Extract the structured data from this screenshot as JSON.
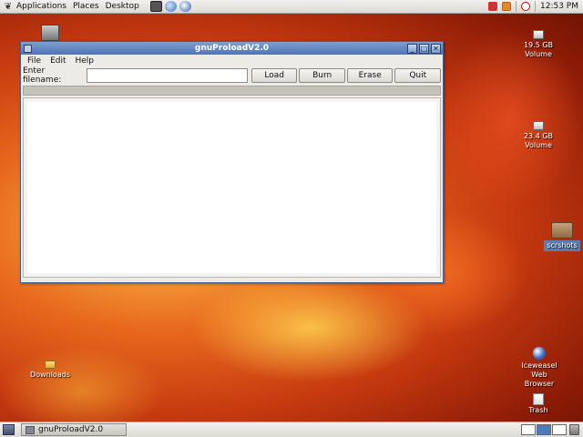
{
  "top_panel": {
    "menus": [
      "Applications",
      "Places",
      "Desktop"
    ],
    "clock": "12:53 PM"
  },
  "desktop_icons": {
    "drive1": {
      "line1": "19.5 GB",
      "line2": "Volume"
    },
    "drive2": {
      "line1": "23.4 GB",
      "line2": "Volume"
    },
    "folder": "scrshots",
    "downloads": "Downloads",
    "browser": {
      "line1": "Iceweasel",
      "line2": "Web",
      "line3": "Browser"
    },
    "trash": "Trash"
  },
  "window": {
    "title": "gnuProloadV2.0",
    "minimize_glyph": "_",
    "maximize_glyph": "□",
    "close_glyph": "✕",
    "menu": [
      "File",
      "Edit",
      "Help"
    ],
    "filename_label": "Enter filename:",
    "filename_value": "",
    "buttons": {
      "load": "Load",
      "burn": "Burn",
      "erase": "Erase",
      "quit": "Quit"
    }
  },
  "taskbar": {
    "task_label": "gnuProloadV2.0"
  },
  "colors": {
    "titlebar": "#4c75b8",
    "wallpaper_accent": "#e8681d"
  }
}
